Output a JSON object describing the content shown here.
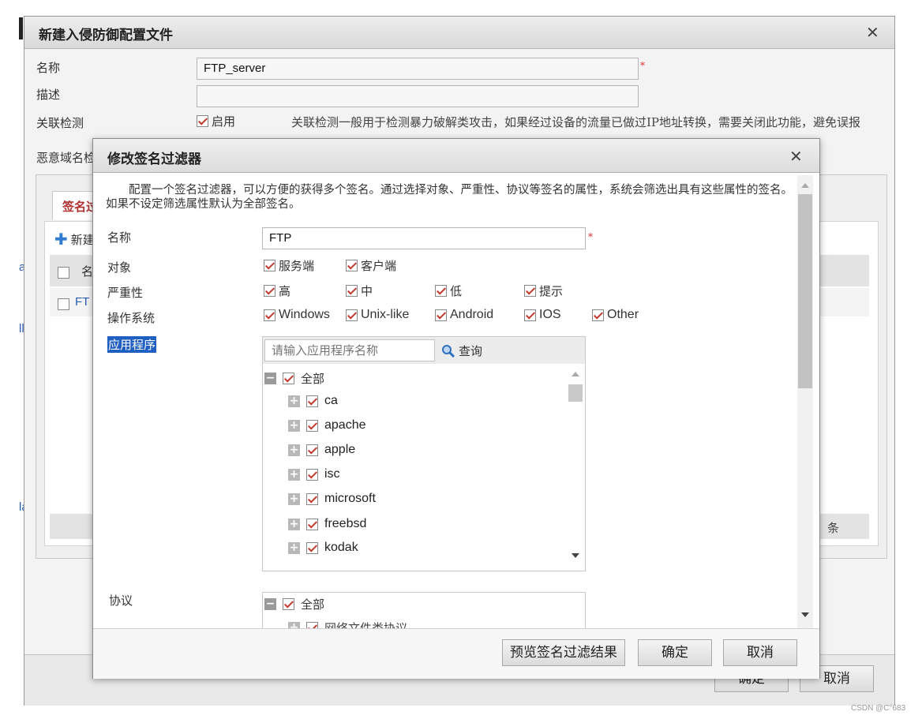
{
  "outer": {
    "title": "新建入侵防御配置文件",
    "fields": {
      "name_label": "名称",
      "name_value": "FTP_server",
      "desc_label": "描述",
      "desc_value": "",
      "assoc_label": "关联检测",
      "assoc_enable": "启用",
      "assoc_note": "关联检测一般用于检测暴力破解类攻击，如果经过设备的流量已做过IP地址转换，需要关闭此功能，避免误报",
      "malicious_label": "恶意域名检"
    },
    "tab_label": "签名过",
    "new_button": "新建",
    "table_header_partial": "名",
    "table_row_partial": "FT",
    "right_cell_partial": "条",
    "ok_button": "确定",
    "cancel_button": "取消"
  },
  "inner": {
    "title": "修改签名过滤器",
    "description": "配置一个签名过滤器，可以方便的获得多个签名。通过选择对象、严重性、协议等签名的属性，系统会筛选出具有这些属性的签名。如果不设定筛选属性默认为全部签名。",
    "name_label": "名称",
    "name_value": "FTP",
    "object_label": "对象",
    "objects": [
      "服务端",
      "客户端"
    ],
    "severity_label": "严重性",
    "severities": [
      "高",
      "中",
      "低",
      "提示"
    ],
    "os_label": "操作系统",
    "os_list": [
      "Windows",
      "Unix-like",
      "Android",
      "IOS",
      "Other"
    ],
    "app_label": "应用程序",
    "app_search_placeholder": "请输入应用程序名称",
    "search_button": "查询",
    "app_tree_root": "全部",
    "app_tree_items": [
      "ca",
      "apache",
      "apple",
      "isc",
      "microsoft",
      "freebsd",
      "kodak"
    ],
    "protocol_label": "协议",
    "protocol_tree_root": "全部",
    "protocol_first_item": "网络文件类协议",
    "preview_button": "预览签名过滤结果",
    "ok_button": "确定",
    "cancel_button": "取消"
  },
  "watermark": "CSDN @C°683"
}
